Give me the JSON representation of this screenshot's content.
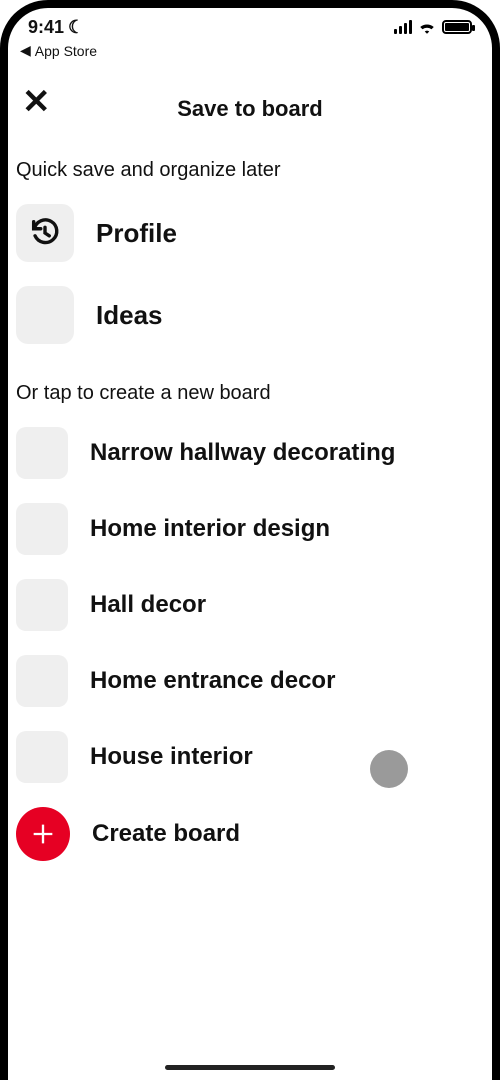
{
  "statusbar": {
    "time": "9:41",
    "back_app": "App Store"
  },
  "header": {
    "title": "Save to board",
    "close_symbol": "✕"
  },
  "sections": {
    "quick_save_label": "Quick save and organize later",
    "create_label": "Or tap to create a new board"
  },
  "quick_boards": [
    {
      "label": "Profile",
      "icon": "history"
    },
    {
      "label": "Ideas",
      "icon": "none"
    }
  ],
  "suggested_boards": [
    {
      "label": "Narrow hallway decorating"
    },
    {
      "label": "Home interior design"
    },
    {
      "label": "Hall decor"
    },
    {
      "label": "Home entrance decor"
    },
    {
      "label": "House interior"
    }
  ],
  "create_board": {
    "label": "Create board"
  }
}
